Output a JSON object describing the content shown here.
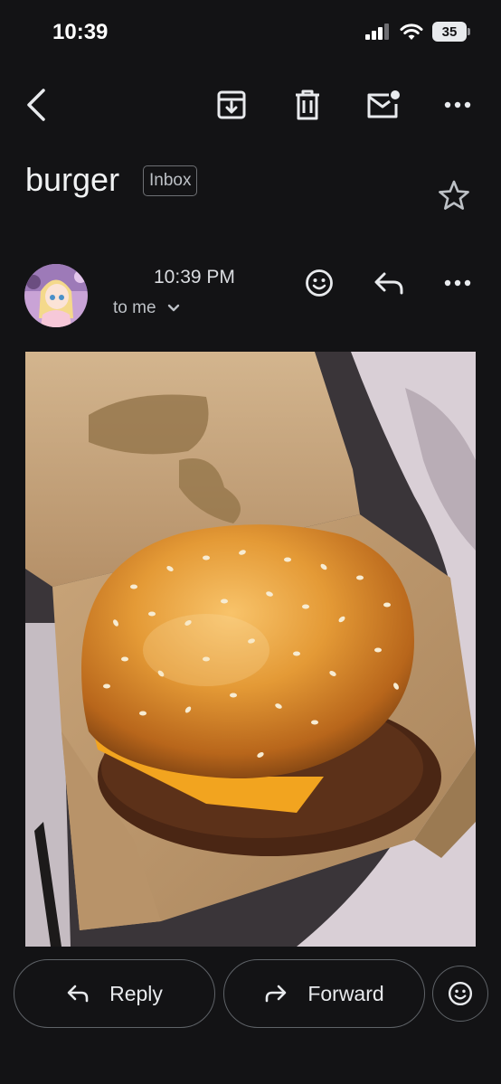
{
  "status_bar": {
    "time": "10:39",
    "battery": "35"
  },
  "toolbar": {
    "back_icon": "back-arrow-icon",
    "archive_icon": "archive-icon",
    "delete_icon": "trash-icon",
    "mark_unread_icon": "mark-unread-icon",
    "more_icon": "more-horizontal-icon"
  },
  "email": {
    "subject": "burger",
    "label": "Inbox",
    "time": "10:39 PM",
    "recipient": "to me"
  },
  "footer": {
    "reply_label": "Reply",
    "forward_label": "Forward"
  },
  "colors": {
    "background": "#131315",
    "text": "#e8eaed",
    "border": "#5f6368"
  }
}
